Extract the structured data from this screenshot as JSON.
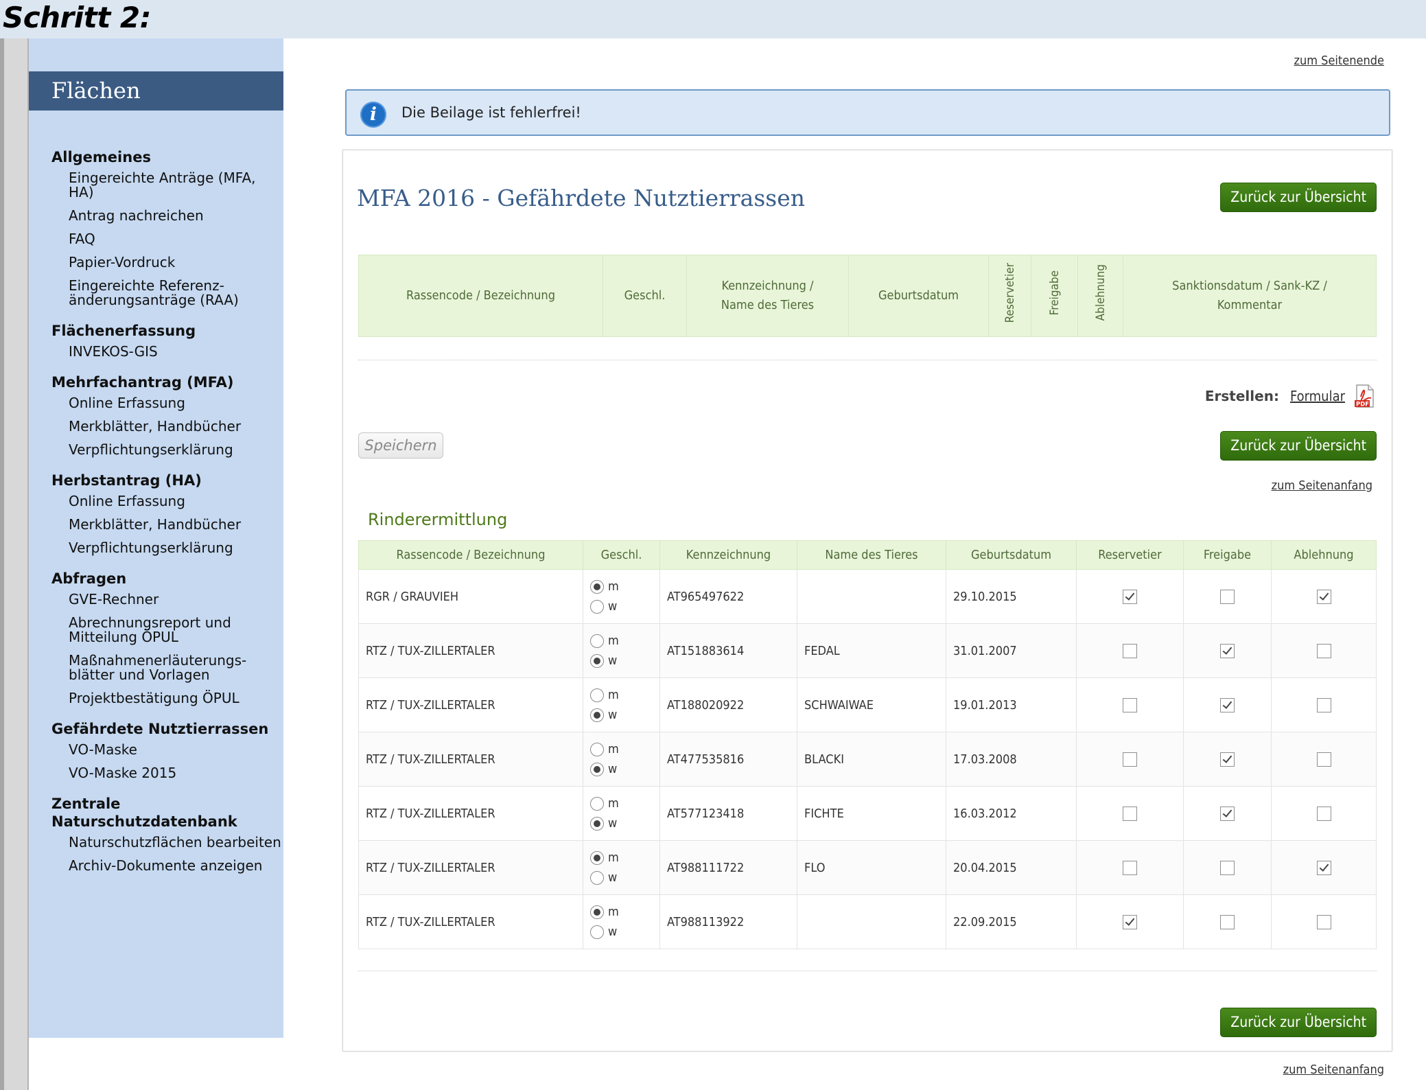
{
  "step_title": "Schritt 2:",
  "sidebar": {
    "header": "Flächen",
    "groups": [
      {
        "heading": "Allgemeines",
        "items": [
          "Eingereichte Anträge (MFA, HA)",
          "Antrag nachreichen",
          "FAQ",
          "Papier-Vordruck",
          "Eingereichte Referenz-änderungsanträge (RAA)"
        ]
      },
      {
        "heading": "Flächenerfassung",
        "items": [
          "INVEKOS-GIS"
        ]
      },
      {
        "heading": "Mehrfachantrag (MFA)",
        "items": [
          "Online Erfassung",
          "Merkblätter, Handbücher",
          "Verpflichtungserklärung"
        ]
      },
      {
        "heading": "Herbstantrag (HA)",
        "items": [
          "Online Erfassung",
          "Merkblätter, Handbücher",
          "Verpflichtungserklärung"
        ]
      },
      {
        "heading": "Abfragen",
        "items": [
          "GVE-Rechner",
          "Abrechnungsreport und Mitteilung ÖPUL",
          "Maßnahmenerläuterungs-blätter und Vorlagen",
          "Projektbestätigung ÖPUL"
        ]
      },
      {
        "heading": "Gefährdete Nutztierrassen",
        "items": [
          "VO-Maske",
          "VO-Maske 2015"
        ]
      },
      {
        "heading": "Zentrale Naturschutzdatenbank",
        "items": [
          "Naturschutzflächen bearbeiten",
          "Archiv-Dokumente anzeigen"
        ]
      }
    ]
  },
  "links": {
    "to_end": "zum Seitenende",
    "to_start": "zum Seitenanfang"
  },
  "info": {
    "message": "Die Beilage ist fehlerfrei!",
    "icon": "info-icon"
  },
  "page_title": "MFA 2016 - Gefährdete Nutztierrassen",
  "buttons": {
    "back": "Zurück zur Übersicht",
    "save": "Speichern"
  },
  "summary_headers": {
    "breed": "Rassencode / Bezeichnung",
    "sex": "Geschl.",
    "id_name": "Kennzeichnung / Name des Tieres",
    "birth": "Geburtsdatum",
    "reserve": "Reservetier",
    "release": "Freigabe",
    "reject": "Ablehnung",
    "sanction": "Sanktionsdatum / Sank-KZ / Kommentar"
  },
  "create": {
    "label": "Erstellen:",
    "link": "Formular",
    "icon": "pdf-icon"
  },
  "section_title": "Rinderermittlung",
  "table_headers": {
    "breed": "Rassencode / Bezeichnung",
    "sex": "Geschl.",
    "id": "Kennzeichnung",
    "name": "Name des Tieres",
    "birth": "Geburtsdatum",
    "reserve": "Reservetier",
    "release": "Freigabe",
    "reject": "Ablehnung"
  },
  "radio_labels": {
    "m": "m",
    "w": "w"
  },
  "rows": [
    {
      "breed": "RGR / GRAUVIEH",
      "sex": "m",
      "id": "AT965497622",
      "name": "",
      "birth": "29.10.2015",
      "reserve": true,
      "release": false,
      "reject": true
    },
    {
      "breed": "RTZ / TUX-ZILLERTALER",
      "sex": "w",
      "id": "AT151883614",
      "name": "FEDAL",
      "birth": "31.01.2007",
      "reserve": false,
      "release": true,
      "reject": false
    },
    {
      "breed": "RTZ / TUX-ZILLERTALER",
      "sex": "w",
      "id": "AT188020922",
      "name": "SCHWAIWAE",
      "birth": "19.01.2013",
      "reserve": false,
      "release": true,
      "reject": false
    },
    {
      "breed": "RTZ / TUX-ZILLERTALER",
      "sex": "w",
      "id": "AT477535816",
      "name": "BLACKI",
      "birth": "17.03.2008",
      "reserve": false,
      "release": true,
      "reject": false
    },
    {
      "breed": "RTZ / TUX-ZILLERTALER",
      "sex": "w",
      "id": "AT577123418",
      "name": "FICHTE",
      "birth": "16.03.2012",
      "reserve": false,
      "release": true,
      "reject": false
    },
    {
      "breed": "RTZ / TUX-ZILLERTALER",
      "sex": "m",
      "id": "AT988111722",
      "name": "FLO",
      "birth": "20.04.2015",
      "reserve": false,
      "release": false,
      "reject": true
    },
    {
      "breed": "RTZ / TUX-ZILLERTALER",
      "sex": "m",
      "id": "AT988113922",
      "name": "",
      "birth": "22.09.2015",
      "reserve": true,
      "release": false,
      "reject": false
    }
  ]
}
